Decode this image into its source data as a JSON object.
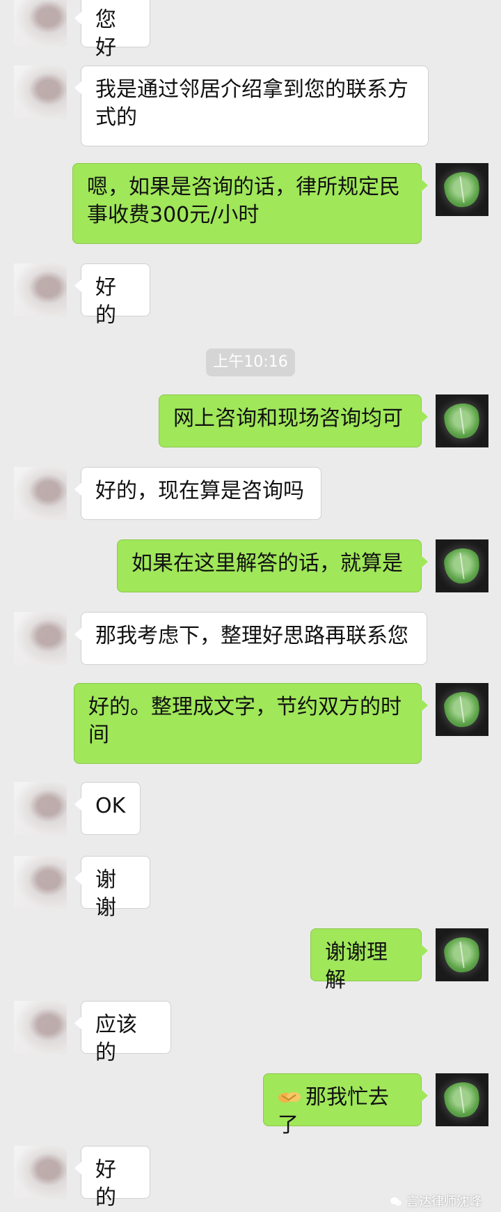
{
  "timestamp": "上午10:16",
  "messages": [
    {
      "side": "left",
      "text": "您好"
    },
    {
      "side": "left",
      "text": "我是通过邻居介绍拿到您的联系方式的"
    },
    {
      "side": "right",
      "text": "嗯，如果是咨询的话，律所规定民事收费300元/小时"
    },
    {
      "side": "left",
      "text": "好的"
    },
    {
      "side": "right",
      "text": "网上咨询和现场咨询均可"
    },
    {
      "side": "left",
      "text": "好的，现在算是咨询吗"
    },
    {
      "side": "right",
      "text": "如果在这里解答的话，就算是"
    },
    {
      "side": "left",
      "text": "那我考虑下，整理好思路再联系您"
    },
    {
      "side": "right",
      "text": "好的。整理成文字，节约双方的时间"
    },
    {
      "side": "left",
      "text": "OK"
    },
    {
      "side": "left",
      "text": "谢谢"
    },
    {
      "side": "right",
      "text": "谢谢理解"
    },
    {
      "side": "left",
      "text": "应该的"
    },
    {
      "side": "right",
      "text": "那我忙去了",
      "emoji": "handshake-emoji"
    },
    {
      "side": "left",
      "text": "好的"
    }
  ],
  "watermark": "言达律师沈峰",
  "colors": {
    "background": "#ebebeb",
    "bubble_self": "#a0e75a",
    "bubble_other": "#ffffff",
    "timestamp_bg": "#d5d5d5"
  }
}
